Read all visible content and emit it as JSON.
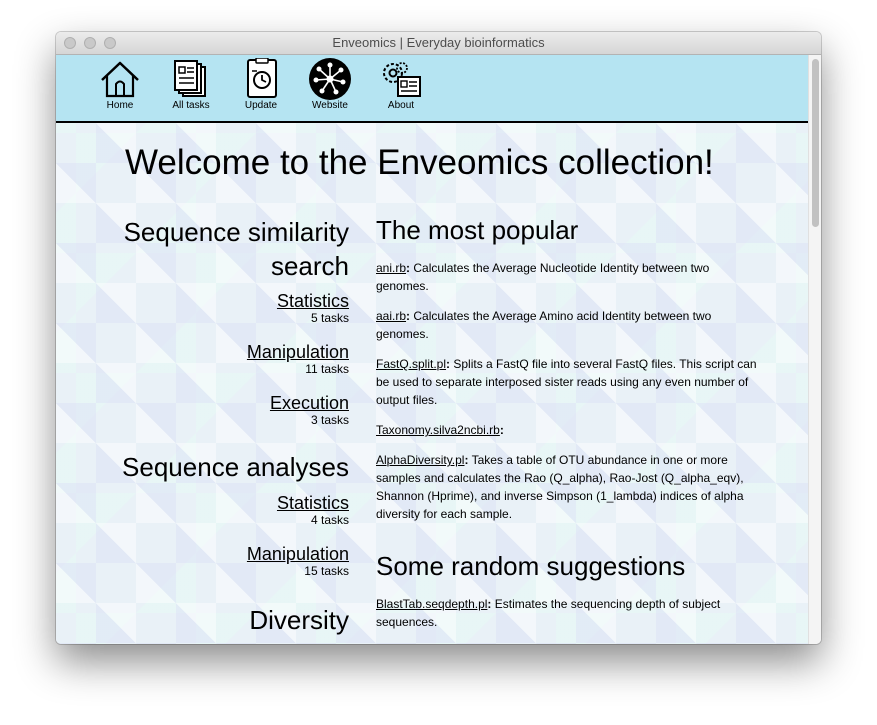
{
  "window": {
    "title": "Enveomics | Everyday bioinformatics"
  },
  "toolbar": {
    "items": [
      {
        "label": "Home",
        "icon": "home-icon"
      },
      {
        "label": "All tasks",
        "icon": "tasks-icon"
      },
      {
        "label": "Update",
        "icon": "update-icon"
      },
      {
        "label": "Website",
        "icon": "website-icon"
      },
      {
        "label": "About",
        "icon": "about-icon"
      }
    ],
    "background": "#b5e4f2"
  },
  "main": {
    "heading": "Welcome to the Enveomics collection!",
    "sections": [
      {
        "title_line1": "Sequence similarity",
        "title_line2": "search",
        "categories": [
          {
            "name": "Statistics",
            "count": "5 tasks"
          },
          {
            "name": "Manipulation",
            "count": "11 tasks"
          },
          {
            "name": "Execution",
            "count": "3 tasks"
          }
        ]
      },
      {
        "title_line1": "Sequence analyses",
        "categories": [
          {
            "name": "Statistics",
            "count": "4 tasks"
          },
          {
            "name": "Manipulation",
            "count": "15 tasks"
          }
        ]
      },
      {
        "title_line1": "Diversity"
      }
    ],
    "popular": {
      "title": "The most popular",
      "entries": [
        {
          "name": "ani.rb",
          "desc": " Calculates the Average Nucleotide Identity between two genomes."
        },
        {
          "name": "aai.rb",
          "desc": " Calculates the Average Amino acid Identity between two genomes."
        },
        {
          "name": "FastQ.split.pl",
          "desc": " Splits a FastQ file into several FastQ files. This script can be used to separate interposed sister reads using any even number of output files."
        },
        {
          "name": "Taxonomy.silva2ncbi.rb",
          "desc": ""
        },
        {
          "name": "AlphaDiversity.pl",
          "desc": " Takes a table of OTU abundance in one or more samples and calculates the Rao (Q_alpha), Rao-Jost (Q_alpha_eqv), Shannon (Hprime), and inverse Simpson (1_lambda) indices of alpha diversity for each sample."
        }
      ]
    },
    "random": {
      "title": "Some random suggestions",
      "entries": [
        {
          "name": "BlastTab.seqdepth.pl",
          "desc": " Estimates the sequencing depth of subject sequences."
        }
      ]
    }
  }
}
